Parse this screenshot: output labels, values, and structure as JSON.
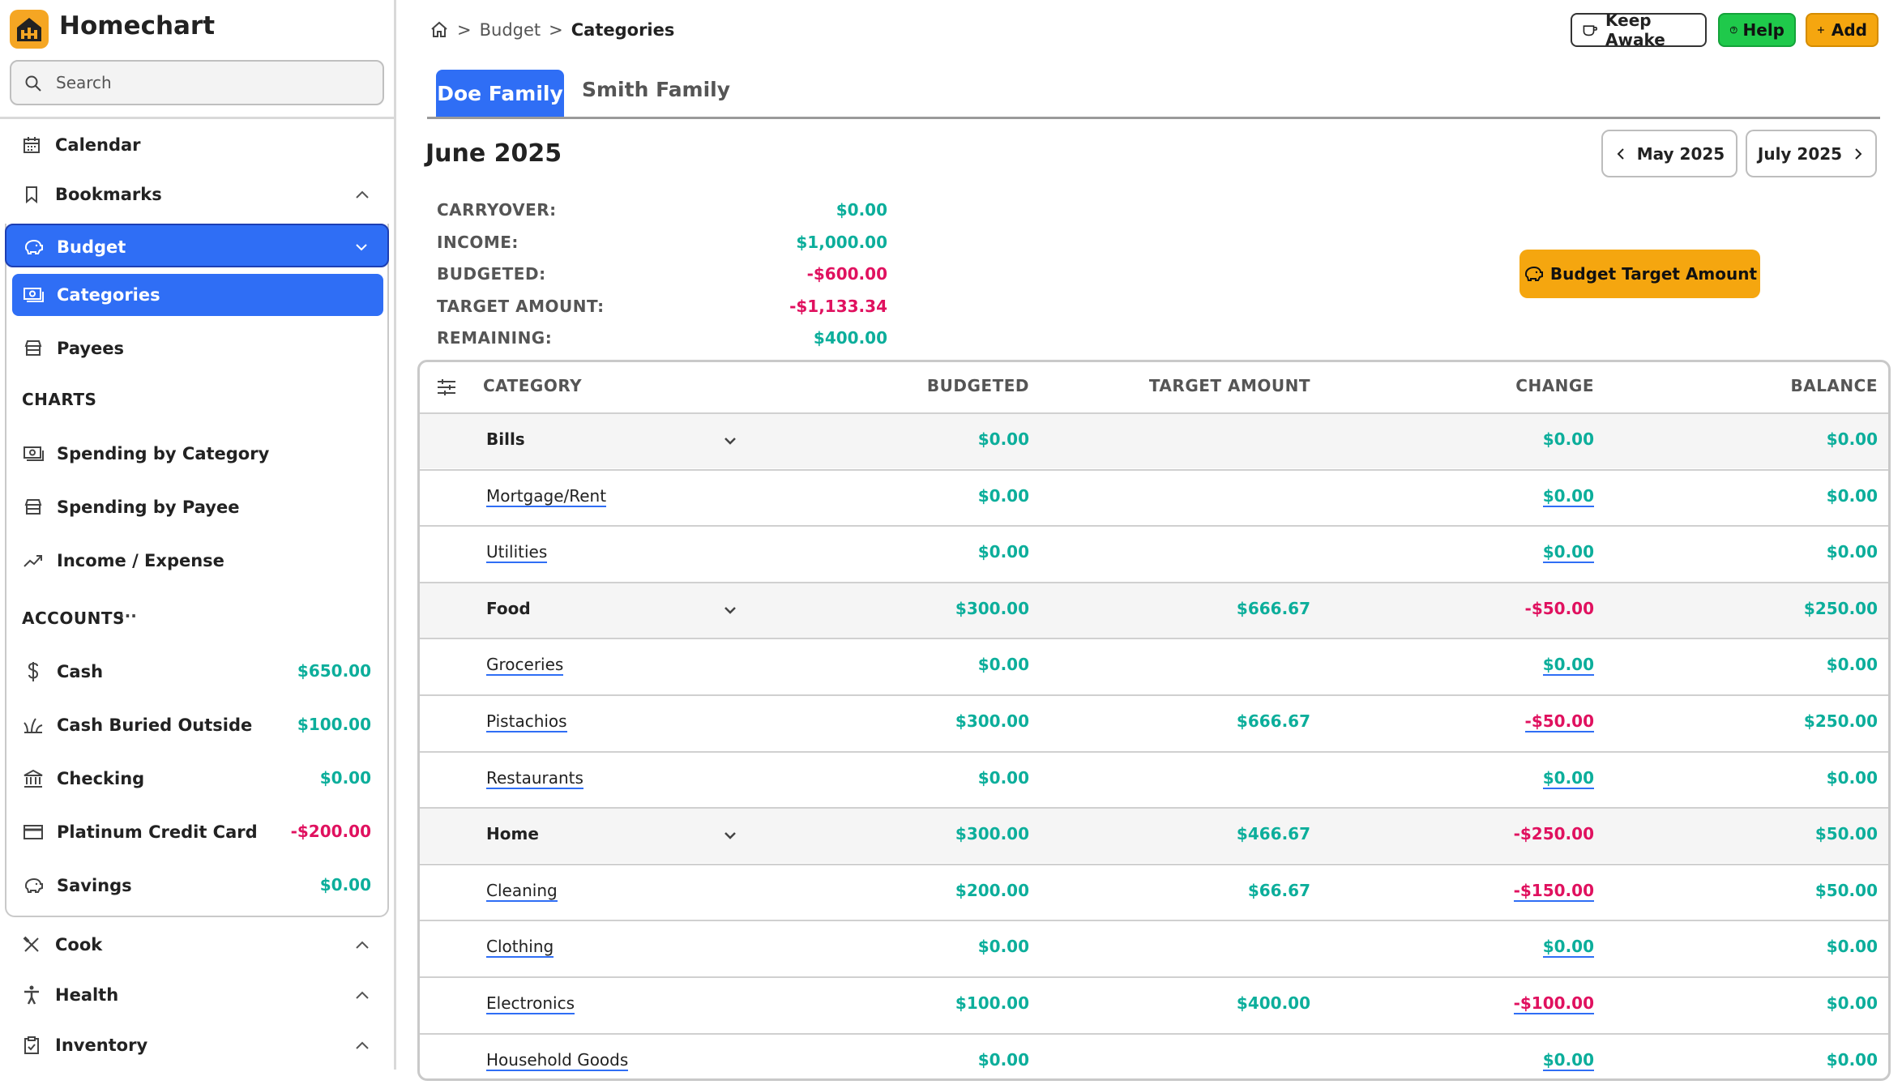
{
  "app": {
    "title": "Homechart"
  },
  "search": {
    "placeholder": "Search"
  },
  "sidebar": {
    "calendar": "Calendar",
    "bookmarks": "Bookmarks",
    "budget": "Budget",
    "categories": "Categories",
    "payees": "Payees",
    "charts_label": "CHARTS",
    "spending_by_category": "Spending by Category",
    "spending_by_payee": "Spending by Payee",
    "income_expense": "Income / Expense",
    "accounts_label": "ACCOUNTS",
    "accounts_more": "···",
    "accounts": [
      {
        "name": "Cash",
        "amount": "$650.00",
        "status": "positive"
      },
      {
        "name": "Cash Buried Outside",
        "amount": "$100.00",
        "status": "positive"
      },
      {
        "name": "Checking",
        "amount": "$0.00",
        "status": "positive"
      },
      {
        "name": "Platinum Credit Card",
        "amount": "-$200.00",
        "status": "negative"
      },
      {
        "name": "Savings",
        "amount": "$0.00",
        "status": "positive"
      }
    ],
    "cook": "Cook",
    "health": "Health",
    "inventory": "Inventory"
  },
  "breadcrumb": {
    "budget": "Budget",
    "current": "Categories"
  },
  "toolbar": {
    "keep_awake": "Keep Awake",
    "help": "Help",
    "add": "Add"
  },
  "tabs": [
    "Doe Family",
    "Smith Family"
  ],
  "month": {
    "title": "June 2025",
    "prev": "May 2025",
    "next": "July 2025"
  },
  "summary": [
    {
      "label": "CARRYOVER:",
      "value": "$0.00",
      "status": "positive"
    },
    {
      "label": "INCOME:",
      "value": "$1,000.00",
      "status": "positive"
    },
    {
      "label": "BUDGETED:",
      "value": "-$600.00",
      "status": "negative"
    },
    {
      "label": "TARGET AMOUNT:",
      "value": "-$1,133.34",
      "status": "negative"
    },
    {
      "label": "REMAINING:",
      "value": "$400.00",
      "status": "positive"
    }
  ],
  "target_button": "Budget Target Amount",
  "table": {
    "headers": {
      "category": "CATEGORY",
      "budgeted": "BUDGETED",
      "target": "TARGET AMOUNT",
      "change": "CHANGE",
      "balance": "BALANCE"
    },
    "rows": [
      {
        "type": "group",
        "name": "Bills",
        "budgeted": "$0.00",
        "target": "",
        "change": "$0.00",
        "balance": "$0.00"
      },
      {
        "type": "item",
        "name": "Mortgage/Rent",
        "budgeted": "$0.00",
        "target": "",
        "change": "$0.00",
        "balance": "$0.00"
      },
      {
        "type": "item",
        "name": "Utilities",
        "budgeted": "$0.00",
        "target": "",
        "change": "$0.00",
        "balance": "$0.00"
      },
      {
        "type": "group",
        "name": "Food",
        "budgeted": "$300.00",
        "target": "$666.67",
        "change": "-$50.00",
        "balance": "$250.00"
      },
      {
        "type": "item",
        "name": "Groceries",
        "budgeted": "$0.00",
        "target": "",
        "change": "$0.00",
        "balance": "$0.00"
      },
      {
        "type": "item",
        "name": "Pistachios",
        "budgeted": "$300.00",
        "target": "$666.67",
        "change": "-$50.00",
        "balance": "$250.00"
      },
      {
        "type": "item",
        "name": "Restaurants",
        "budgeted": "$0.00",
        "target": "",
        "change": "$0.00",
        "balance": "$0.00"
      },
      {
        "type": "group",
        "name": "Home",
        "budgeted": "$300.00",
        "target": "$466.67",
        "change": "-$250.00",
        "balance": "$50.00"
      },
      {
        "type": "item",
        "name": "Cleaning",
        "budgeted": "$200.00",
        "target": "$66.67",
        "change": "-$150.00",
        "balance": "$50.00"
      },
      {
        "type": "item",
        "name": "Clothing",
        "budgeted": "$0.00",
        "target": "",
        "change": "$0.00",
        "balance": "$0.00"
      },
      {
        "type": "item",
        "name": "Electronics",
        "budgeted": "$100.00",
        "target": "$400.00",
        "change": "-$100.00",
        "balance": "$0.00"
      },
      {
        "type": "item",
        "name": "Household Goods",
        "budgeted": "$0.00",
        "target": "",
        "change": "$0.00",
        "balance": "$0.00"
      }
    ]
  },
  "colors": {
    "accent": "#2f6ef5",
    "positive": "#0cae9b",
    "negative": "#e0115f",
    "orange": "#f5a60f",
    "green": "#1fc94b"
  }
}
